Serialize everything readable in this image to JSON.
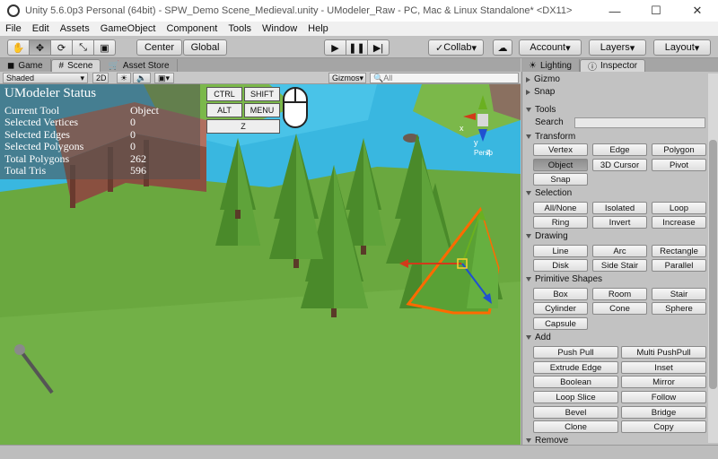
{
  "window": {
    "title": "Unity 5.6.0p3 Personal (64bit) - SPW_Demo Scene_Medieval.unity - UModeler_Raw - PC, Mac & Linux Standalone* <DX11>"
  },
  "menu": [
    "File",
    "Edit",
    "Assets",
    "GameObject",
    "Component",
    "Tools",
    "Window",
    "Help"
  ],
  "toolbar": {
    "tools": [
      "hand-tool",
      "move-tool",
      "rotate-tool",
      "scale-tool",
      "rect-tool"
    ],
    "pivot_label": "Center",
    "space_label": "Global",
    "play_icons": [
      "play",
      "pause",
      "step"
    ],
    "collab_label": "Collab",
    "account_label": "Account",
    "layers_label": "Layers",
    "layout_label": "Layout"
  },
  "tabs": {
    "left": [
      "Game",
      "Scene",
      "Asset Store"
    ],
    "right": [
      "Lighting",
      "Inspector"
    ]
  },
  "scene_bar": {
    "shading": "Shaded",
    "mode_2d": "2D",
    "gizmos": "Gizmos",
    "search_placeholder": "All"
  },
  "umodeler_status": {
    "title": "UModeler Status",
    "rows": [
      {
        "label": "Current Tool",
        "value": "Object"
      },
      {
        "label": "Selected Vertices",
        "value": "0"
      },
      {
        "label": "Selected Edges",
        "value": "0"
      },
      {
        "label": "Selected Polygons",
        "value": "0"
      },
      {
        "label": "Total Polygons",
        "value": "262"
      },
      {
        "label": "Total Tris",
        "value": "596"
      }
    ]
  },
  "key_hints": {
    "ctrl": "CTRL",
    "shift": "SHIFT",
    "alt": "ALT",
    "menu": "MENU",
    "z": "Z"
  },
  "gizmo": {
    "axis_label": "Persp",
    "y": "y",
    "x": "x",
    "z": "z"
  },
  "inspector": {
    "gizmo": "Gizmo",
    "snap": "Snap",
    "tools": "Tools",
    "search_label": "Search",
    "transform": {
      "title": "Transform",
      "buttons": [
        "Vertex",
        "Edge",
        "Polygon",
        "Object",
        "3D Cursor",
        "Pivot",
        "Snap"
      ]
    },
    "selection": {
      "title": "Selection",
      "buttons": [
        "All/None",
        "Isolated",
        "Loop",
        "Ring",
        "Invert",
        "Increase"
      ]
    },
    "drawing": {
      "title": "Drawing",
      "buttons": [
        "Line",
        "Arc",
        "Rectangle",
        "Disk",
        "Side Stair",
        "Parallel"
      ]
    },
    "primitive": {
      "title": "Primitive Shapes",
      "buttons": [
        "Box",
        "Room",
        "Stair",
        "Cylinder",
        "Cone",
        "Sphere",
        "Capsule"
      ]
    },
    "add": {
      "title": "Add",
      "buttons": [
        "Push Pull",
        "Multi PushPull",
        "Extrude Edge",
        "Inset",
        "Boolean",
        "Mirror",
        "Loop Slice",
        "Follow",
        "Bevel",
        "Bridge",
        "Clone",
        "Copy"
      ]
    },
    "remove": "Remove"
  },
  "colors": {
    "accent_orange": "#ff6a00",
    "grass": "#6aa83f",
    "water": "#39b7e0"
  }
}
